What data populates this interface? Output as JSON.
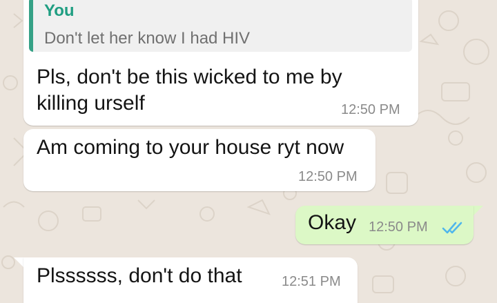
{
  "theme": {
    "wallpaper": "#ece5dd",
    "incoming_bubble": "#ffffff",
    "outgoing_bubble": "#dcf8c6",
    "quote_accent": "#35a186",
    "read_tick": "#4fb6ec"
  },
  "messages": [
    {
      "direction": "incoming",
      "quoted": {
        "author": "You",
        "text": "Don't  let her know I had HIV"
      },
      "lines": [
        "Pls, don't be this wicked to me by",
        "killing urself"
      ],
      "time": "12:50 PM"
    },
    {
      "direction": "incoming",
      "text": "Am coming to your house ryt now",
      "time": "12:50 PM"
    },
    {
      "direction": "outgoing",
      "text": "Okay",
      "time": "12:50 PM",
      "status_icon": "double-check-read-icon"
    },
    {
      "direction": "incoming",
      "text": "Plssssss,  don't do that",
      "time": "12:51 PM"
    }
  ]
}
